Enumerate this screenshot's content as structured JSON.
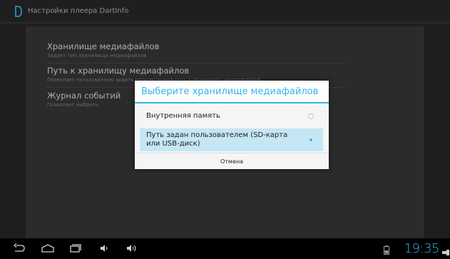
{
  "titlebar": {
    "title": "Настройки плеера DartInfo"
  },
  "preferences": [
    {
      "title": "Хранилище медиафайлов",
      "subtitle": "Задает тип хранилища медиафайлов"
    },
    {
      "title": "Путь к хранилищу медиафайлов",
      "subtitle": "Позволяет пользователю задать произвольный путь к хранилищу медиафайлов"
    },
    {
      "title": "Журнал событий",
      "subtitle": "Позволяет выбрать"
    }
  ],
  "dialog": {
    "title": "Выберите хранилище медиафайлов",
    "options": [
      {
        "label": "Внутренняя память",
        "checked": false
      },
      {
        "label": "Путь задан пользователем (SD-карта или USB-диск)",
        "checked": true
      }
    ],
    "cancel_label": "Отмена"
  },
  "statusbar": {
    "time": "19:35"
  },
  "colors": {
    "accent": "#33b5e5",
    "selected_bg": "#c5e6f4"
  }
}
